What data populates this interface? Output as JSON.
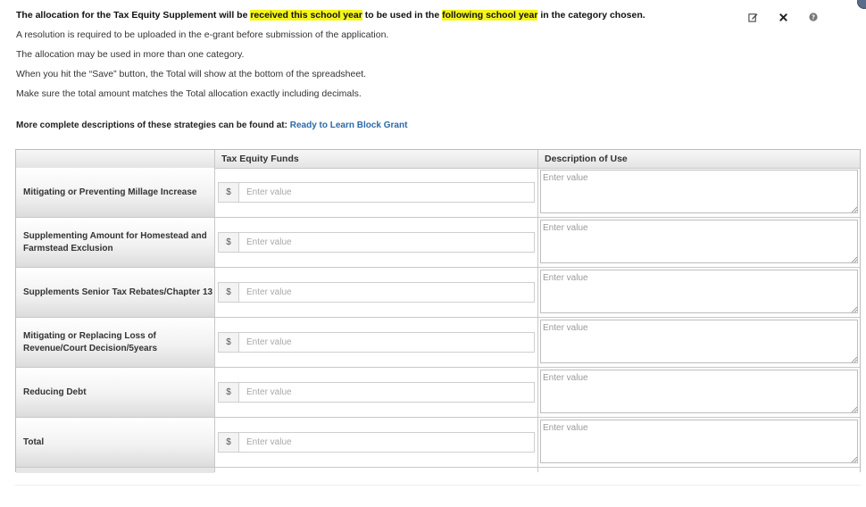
{
  "intro": {
    "line1": {
      "part1": "The allocation for the Tax Equity Supplement will be ",
      "hl1": "received this school year",
      "part2": " to be used in the ",
      "hl2": "following school year",
      "part3": " in the category chosen."
    },
    "lines": [
      "A resolution is required to be uploaded in the e-grant before submission of the application.",
      "The allocation may be used in more than one category.",
      "When you hit the “Save” button, the Total will show at the bottom of the spreadsheet.",
      "Make sure the total amount matches the Total allocation exactly including decimals."
    ]
  },
  "toolbar": {
    "edit_icon": "edit-icon",
    "close_icon": "close-icon",
    "help_icon": "help-icon"
  },
  "more_info": {
    "text": "More complete descriptions of these strategies can be found at: ",
    "link": "Ready to Learn Block Grant"
  },
  "table": {
    "headers": [
      "",
      "Tax Equity Funds",
      "Description of Use"
    ],
    "currency_symbol": "$",
    "amount_placeholder": "Enter value",
    "description_placeholder": "Enter value",
    "rows": [
      {
        "label": "Mitigating or Preventing Millage Increase"
      },
      {
        "label": "Supplementing Amount for Homestead and Farmstead Exclusion"
      },
      {
        "label": "Supplements Senior Tax Rebates/Chapter 13"
      },
      {
        "label": "Mitigating or Replacing Loss of Revenue/Court Decision/5years"
      },
      {
        "label": "Reducing Debt"
      },
      {
        "label": "Total"
      }
    ]
  },
  "colors": {
    "highlight": "#f5f51a",
    "link": "#2c6aa8"
  }
}
